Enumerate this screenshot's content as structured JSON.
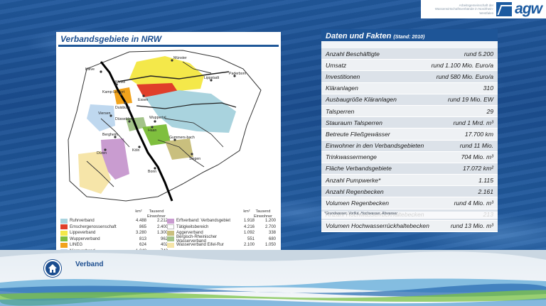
{
  "logo": {
    "tagline": "Arbeitsgemeinschaft der Wasserwirtschaftsverbände in Nordrhein-Westfalen",
    "word": "agw"
  },
  "map_panel": {
    "title": "Verbandsgebiete in NRW",
    "places": [
      "Münster",
      "Kleve",
      "Wesel",
      "Lippstadt",
      "Paderborn",
      "Kamp-Lintfort",
      "Essen",
      "Duisburg",
      "Viersen",
      "Düsseldorf",
      "Wuppertal",
      "Haan",
      "Gummers-bach",
      "Bergheim",
      "Köln",
      "Düren",
      "Bonn",
      "Siegen"
    ],
    "legend": {
      "header_km2": "km²",
      "header_tsd": "Tausend Einwohner",
      "left": [
        {
          "name": "Ruhrverband",
          "km2": "4.488",
          "tsd": "2.212",
          "color": "#a9d3de"
        },
        {
          "name": "Emschergenossenschaft",
          "km2": "865",
          "tsd": "2.400",
          "color": "#e03e2a"
        },
        {
          "name": "Lippeverband",
          "km2": "3.280",
          "tsd": "1.300",
          "color": "#f4e84a"
        },
        {
          "name": "Wupperverband",
          "km2": "813",
          "tsd": "962",
          "color": "#7fbf3e"
        },
        {
          "name": "LINEG",
          "km2": "624",
          "tsd": "402",
          "color": "#f2a31c"
        },
        {
          "name": "Niersverband",
          "km2": "1.348",
          "tsd": "742",
          "color": "#bfd8ef"
        }
      ],
      "right": [
        {
          "name": "Erftverband: Verbandsgebiet",
          "km2": "1.918",
          "tsd": "1.200",
          "color": "#c99cd0"
        },
        {
          "name": "Tätigkeitsbereich",
          "km2": "4.216",
          "tsd": "2.700",
          "color": "#ffffff"
        },
        {
          "name": "Aggerverband",
          "km2": "1.092",
          "tsd": "338",
          "color": "#c9bf7e"
        },
        {
          "name": "Bergisch-Rheinischer Wasserverband",
          "km2": "551",
          "tsd": "680",
          "color": "#a3c389"
        },
        {
          "name": "Wasserverband Eifel-Rur",
          "km2": "2.100",
          "tsd": "1.050",
          "color": "#f6e5a9"
        }
      ]
    }
  },
  "facts_panel": {
    "title": "Daten und Fakten",
    "subtitle": "(Stand: 2010)",
    "rows": [
      {
        "label": "Anzahl Beschäftigte",
        "value": "rund 5.200"
      },
      {
        "label": "Umsatz",
        "value": "rund 1.100 Mio. Euro/a"
      },
      {
        "label": "Investitionen",
        "value": "rund 580 Mio. Euro/a"
      },
      {
        "label": "Kläranlagen",
        "value": "310"
      },
      {
        "label": "Ausbaugröße Kläranlagen",
        "value": "rund 19 Mio. EW"
      },
      {
        "label": "Talsperren",
        "value": "29"
      },
      {
        "label": "Stauraum Talsperren",
        "value": "rund 1 Mrd. m³"
      },
      {
        "label": "Betreute Fließgewässer",
        "value": "17.700 km"
      },
      {
        "label": "Einwohner in den Verbandsgebieten",
        "value": "rund 11 Mio."
      },
      {
        "label": "Trinkwassermenge",
        "value": "704 Mio. m³"
      },
      {
        "label": "Fläche Verbandsgebiete",
        "value": "17.072 km²"
      },
      {
        "label": "Anzahl Pumpwerke*",
        "value": "1.115"
      },
      {
        "label": "Anzahl Regenbecken",
        "value": "2.161"
      },
      {
        "label": "Volumen Regenbecken",
        "value": "rund 4 Mio. m³"
      },
      {
        "label": "Anzahl Hochwasserrückhaltebecken",
        "value": "213"
      },
      {
        "label": "Volumen Hochwasserrückhaltebecken",
        "value": "rund 13 Mio. m³"
      }
    ],
    "footnote": "*Grundwasser, Vorflut, Hochwasser, Abwasser"
  },
  "nav": {
    "home_icon": "home-icon",
    "label": "Verband"
  }
}
